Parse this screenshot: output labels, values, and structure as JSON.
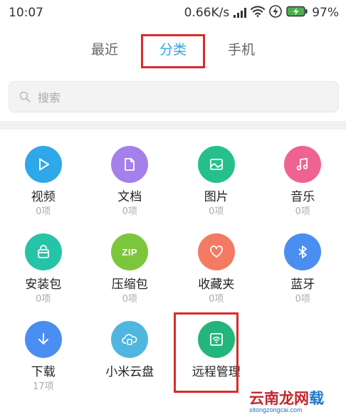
{
  "status_bar": {
    "time": "10:07",
    "network_speed": "0.66K/s",
    "battery": "97%"
  },
  "tabs": [
    {
      "label": "最近",
      "active": false
    },
    {
      "label": "分类",
      "active": true
    },
    {
      "label": "手机",
      "active": false
    }
  ],
  "search": {
    "placeholder": "搜索"
  },
  "categories": [
    {
      "label": "视频",
      "count": "0项",
      "icon": "play-icon",
      "color": "#2ea8e8"
    },
    {
      "label": "文档",
      "count": "0项",
      "icon": "document-icon",
      "color": "#a380ea"
    },
    {
      "label": "图片",
      "count": "0项",
      "icon": "image-icon",
      "color": "#26c08a"
    },
    {
      "label": "音乐",
      "count": "0项",
      "icon": "music-icon",
      "color": "#f06292"
    },
    {
      "label": "安装包",
      "count": "0项",
      "icon": "package-icon",
      "color": "#26c4a6"
    },
    {
      "label": "压缩包",
      "count": "0项",
      "icon": "zip-icon",
      "icon_text": "ZIP",
      "color": "#7cc63b"
    },
    {
      "label": "收藏夹",
      "count": "0项",
      "icon": "heart-icon",
      "color": "#f47a62"
    },
    {
      "label": "蓝牙",
      "count": "0项",
      "icon": "bluetooth-icon",
      "color": "#4a8ef2"
    },
    {
      "label": "下载",
      "count": "17项",
      "icon": "download-icon",
      "color": "#4a8ef2"
    },
    {
      "label": "小米云盘",
      "count": "",
      "icon": "cloud-icon",
      "color": "#4fb6df"
    },
    {
      "label": "远程管理",
      "count": "",
      "icon": "remote-icon",
      "color": "#24b57d"
    }
  ],
  "watermark": {
    "main_red": "云南龙网",
    "main_blue": "载",
    "sub": "xitongzongcai.com"
  }
}
